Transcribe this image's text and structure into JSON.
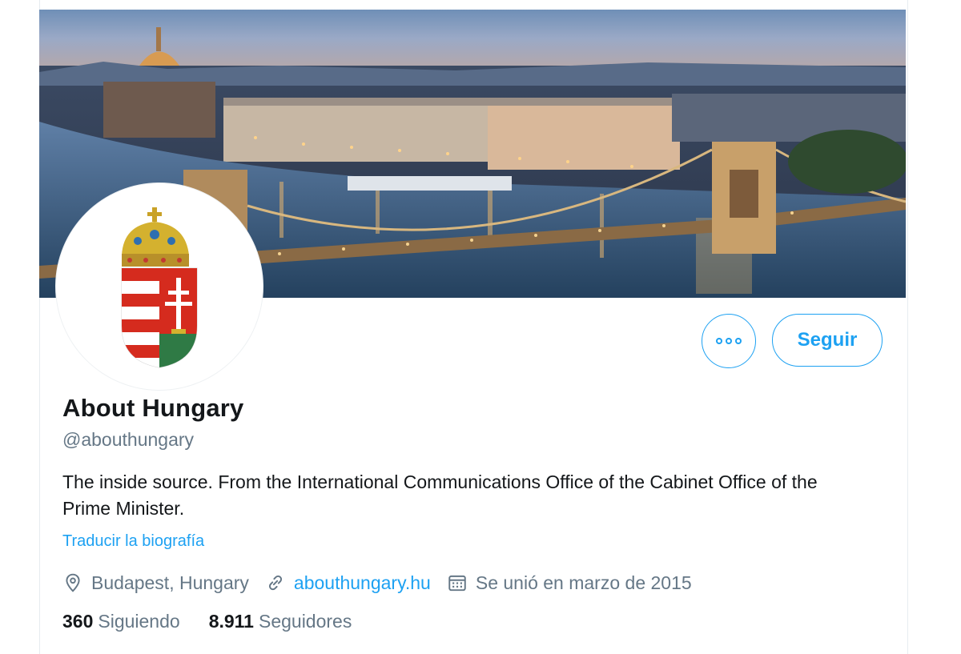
{
  "profile": {
    "display_name": "About Hungary",
    "handle": "@abouthungary",
    "bio": "The inside source. From the International Communications Office of the Cabinet Office of the Prime Minister.",
    "translate_link": "Traducir la biografía",
    "location": "Budapest, Hungary",
    "website": "abouthungary.hu",
    "joined": "Se unió en marzo de 2015"
  },
  "actions": {
    "follow_label": "Seguir",
    "more_icon": "more-options-icon"
  },
  "stats": {
    "following_count": "360",
    "following_label": "Siguiendo",
    "followers_count": "8.911",
    "followers_label": "Seguidores"
  },
  "colors": {
    "accent": "#1da1f2",
    "secondary_text": "#657786",
    "primary_text": "#14171a"
  },
  "icons": {
    "location": "location-pin-icon",
    "website": "link-icon",
    "joined": "calendar-icon"
  }
}
